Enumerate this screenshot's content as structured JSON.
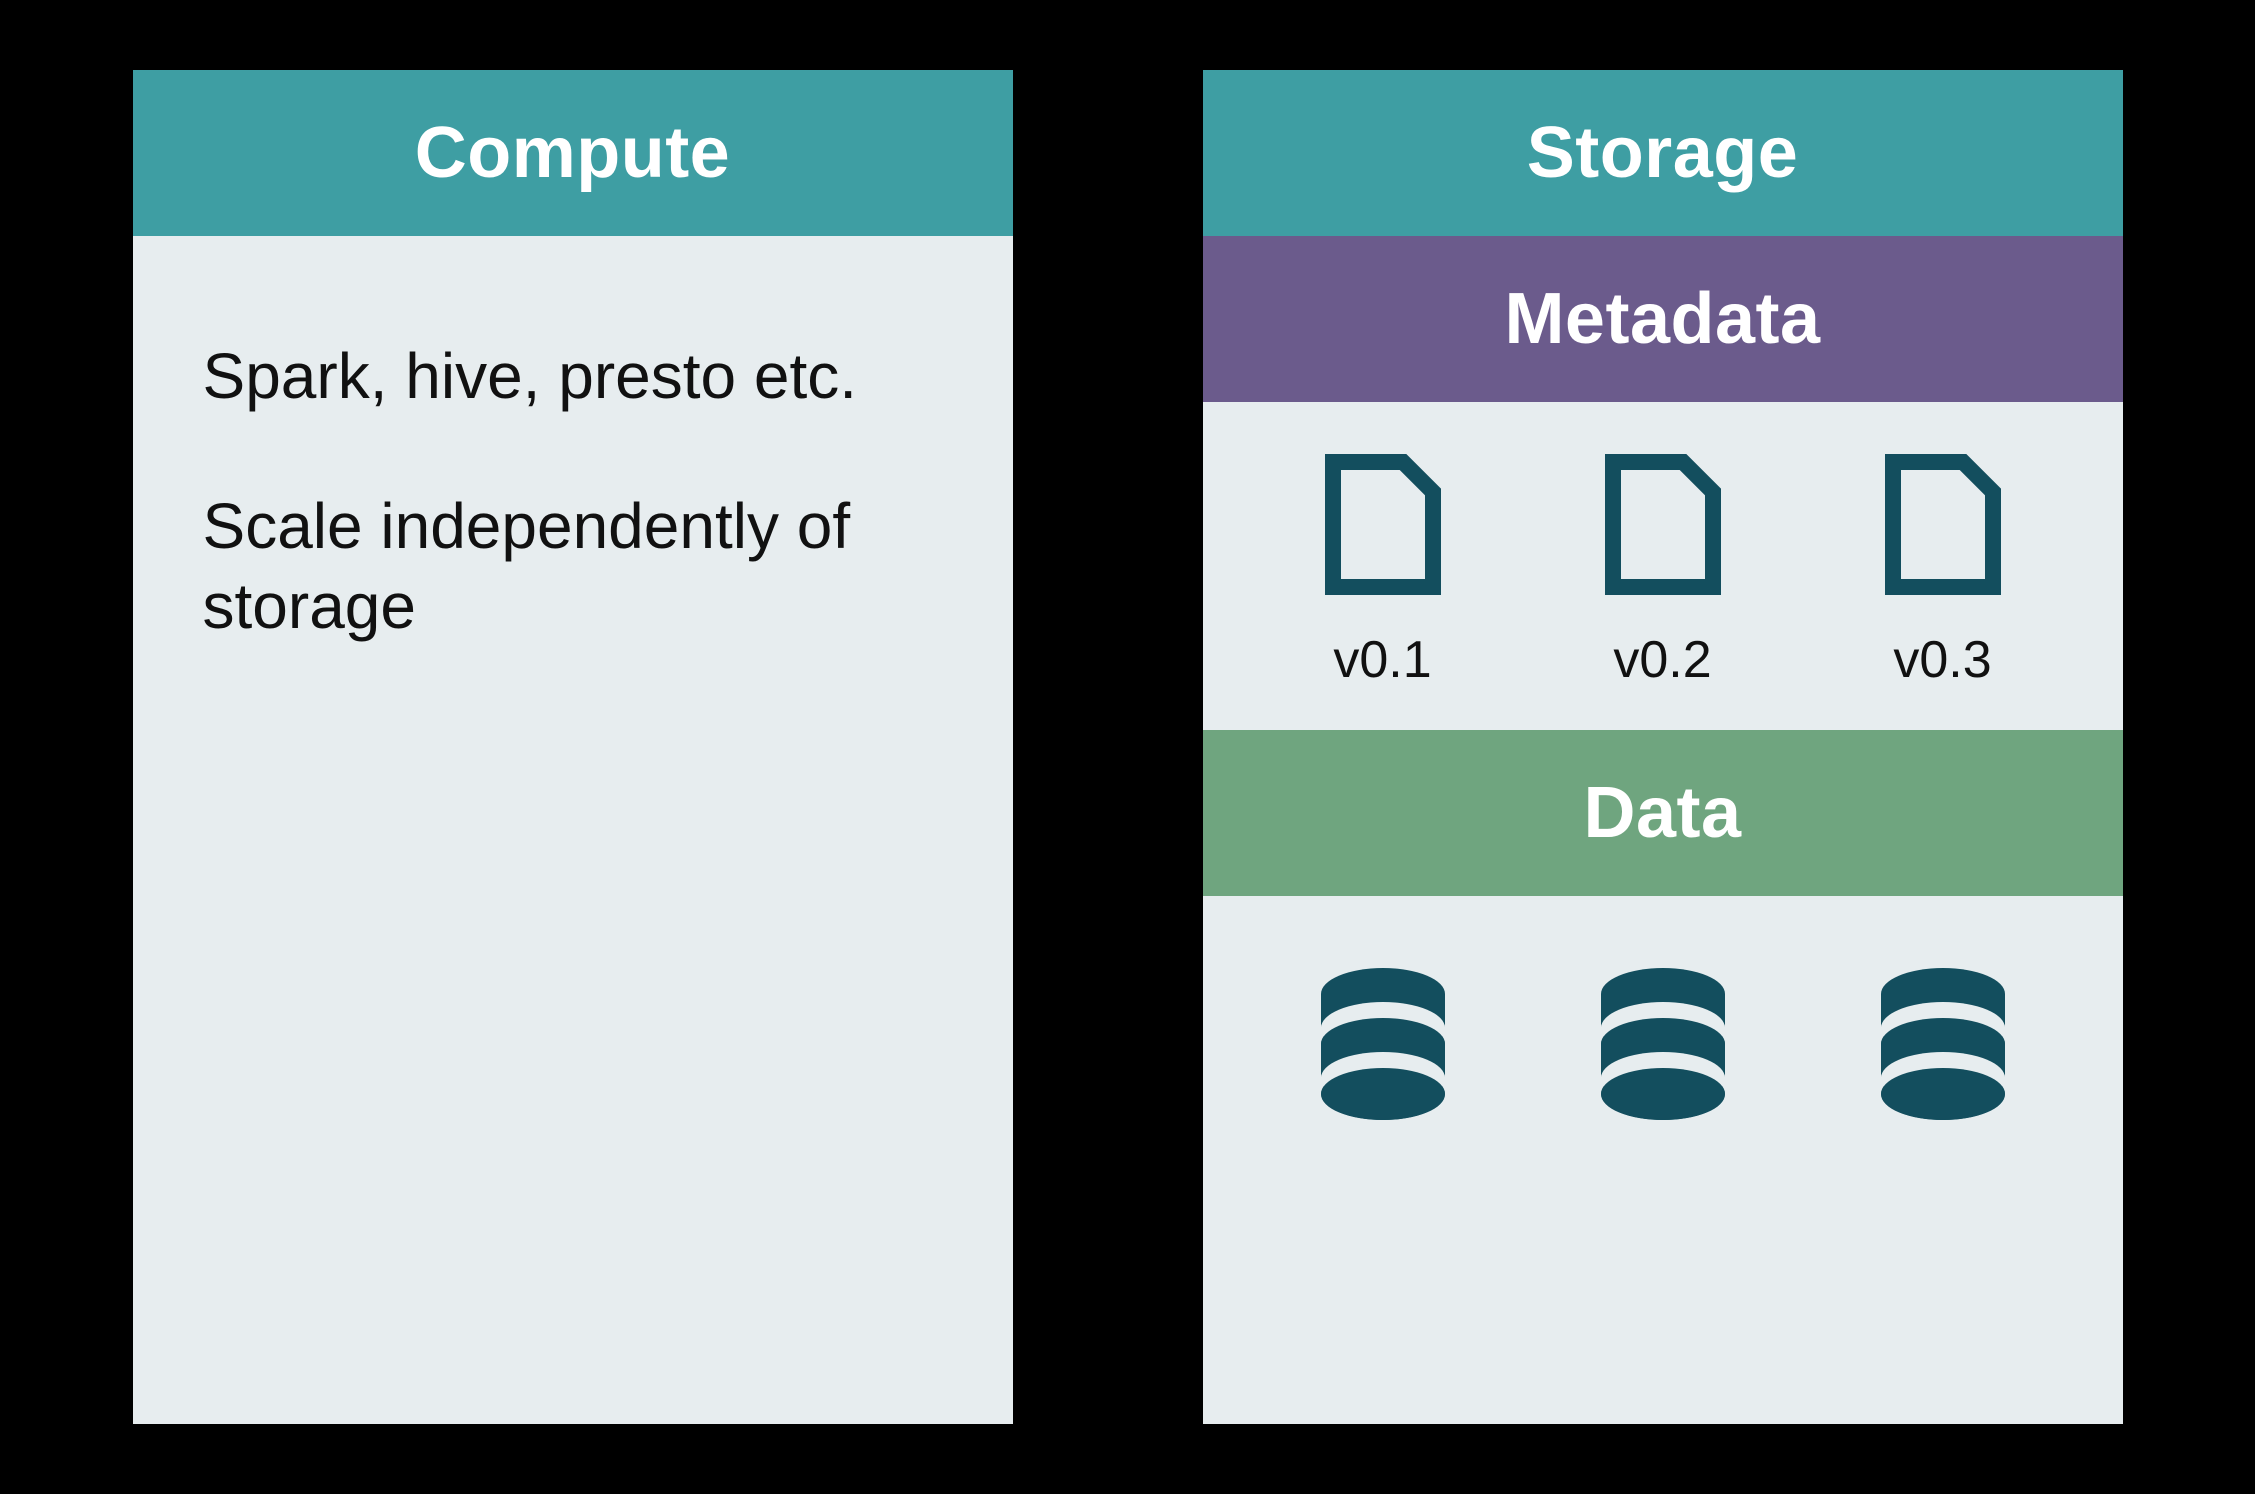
{
  "colors": {
    "teal": "#3e9ea3",
    "purple": "#6b5b8c",
    "green": "#6fa57f",
    "panel_bg": "#e7edef",
    "icon_dark": "#134e5e",
    "text": "#111111"
  },
  "compute": {
    "title": "Compute",
    "line1": "Spark, hive, presto etc.",
    "line2": "Scale independently of storage"
  },
  "storage": {
    "title": "Storage",
    "metadata": {
      "title": "Metadata",
      "versions": [
        "v0.1",
        "v0.2",
        "v0.3"
      ],
      "icon": "file-icon"
    },
    "data": {
      "title": "Data",
      "stores": 3,
      "icon": "database-icon"
    }
  }
}
